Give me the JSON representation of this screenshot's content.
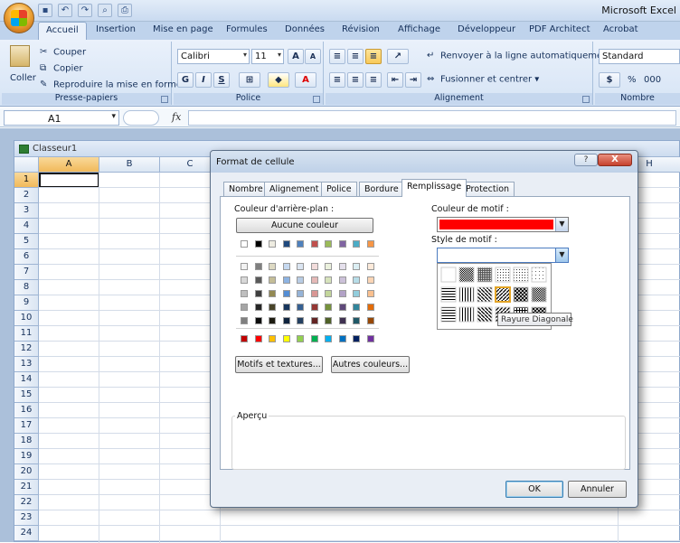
{
  "app": {
    "title": "Microsoft Excel"
  },
  "ribbon": {
    "tabs": [
      "Accueil",
      "Insertion",
      "Mise en page",
      "Formules",
      "Données",
      "Révision",
      "Affichage",
      "Développeur",
      "PDF Architect",
      "Acrobat"
    ],
    "active_tab": "Accueil",
    "clipboard": {
      "paste": "Coller",
      "cut": "Couper",
      "copy": "Copier",
      "format_painter": "Reproduire la mise en forme",
      "group": "Presse-papiers"
    },
    "font": {
      "name": "Calibri",
      "size": "11",
      "group": "Police",
      "bold": "G",
      "italic": "I",
      "underline": "S"
    },
    "alignment": {
      "wrap": "Renvoyer à la ligne automatiquement",
      "merge": "Fusionner et centrer",
      "group": "Alignement"
    },
    "number": {
      "format": "Standard",
      "percent": "%",
      "thousands": "000",
      "group": "Nombre"
    }
  },
  "formula_bar": {
    "name_box": "A1",
    "fx": "fx"
  },
  "workbook": {
    "title": "Classeur1",
    "columns": [
      "A",
      "B",
      "C"
    ],
    "last_column": "H",
    "rows": [
      "1",
      "2",
      "3",
      "4",
      "5",
      "6",
      "7",
      "8",
      "9",
      "10",
      "11",
      "12",
      "13",
      "14",
      "15",
      "16",
      "17",
      "18",
      "19",
      "20",
      "21",
      "22",
      "23",
      "24"
    ]
  },
  "dialog": {
    "title": "Format de cellule",
    "help": "?",
    "close": "X",
    "tabs": [
      "Nombre",
      "Alignement",
      "Police",
      "Bordure",
      "Remplissage",
      "Protection"
    ],
    "active_tab": "Remplissage",
    "background_label": "Couleur d'arrière-plan :",
    "no_color": "Aucune couleur",
    "pattern_color_label": "Couleur de motif :",
    "pattern_color_value": "#ff0000",
    "pattern_style_label": "Style de motif :",
    "tooltip": "Rayure Diagonale",
    "patterns_button": "Motifs et textures...",
    "more_colors_button": "Autres couleurs...",
    "preview_label": "Aperçu",
    "ok": "OK",
    "cancel": "Annuler"
  },
  "palette": {
    "theme_top": [
      "#ffffff",
      "#000000",
      "#eeece1",
      "#1f497d",
      "#4f81bd",
      "#c0504d",
      "#9bbb59",
      "#8064a2",
      "#4bacc6",
      "#f79646"
    ],
    "theme_rows": [
      [
        "#f2f2f2",
        "#7f7f7f",
        "#ddd9c3",
        "#c6d9f0",
        "#dbe5f1",
        "#f2dcdb",
        "#ebf1dd",
        "#e5e0ec",
        "#dbeef3",
        "#fdeada"
      ],
      [
        "#d8d8d8",
        "#595959",
        "#c4bd97",
        "#8db3e2",
        "#b8cce4",
        "#e5b9b7",
        "#d7e3bc",
        "#ccc1d9",
        "#b7dde8",
        "#fbd5b5"
      ],
      [
        "#bfbfbf",
        "#3f3f3f",
        "#938953",
        "#548dd4",
        "#95b3d7",
        "#d99694",
        "#c3d69b",
        "#b2a2c7",
        "#92cddc",
        "#fac08f"
      ],
      [
        "#a5a5a5",
        "#262626",
        "#494429",
        "#17365d",
        "#366092",
        "#953734",
        "#76923c",
        "#5f497a",
        "#31859b",
        "#e36c09"
      ],
      [
        "#7f7f7f",
        "#0c0c0c",
        "#1d1b10",
        "#0f243e",
        "#244061",
        "#632423",
        "#4f6128",
        "#3f3151",
        "#205867",
        "#974806"
      ]
    ],
    "standard": [
      "#c00000",
      "#ff0000",
      "#ffc000",
      "#ffff00",
      "#92d050",
      "#00b050",
      "#00b0f0",
      "#0070c0",
      "#002060",
      "#7030a0"
    ]
  }
}
